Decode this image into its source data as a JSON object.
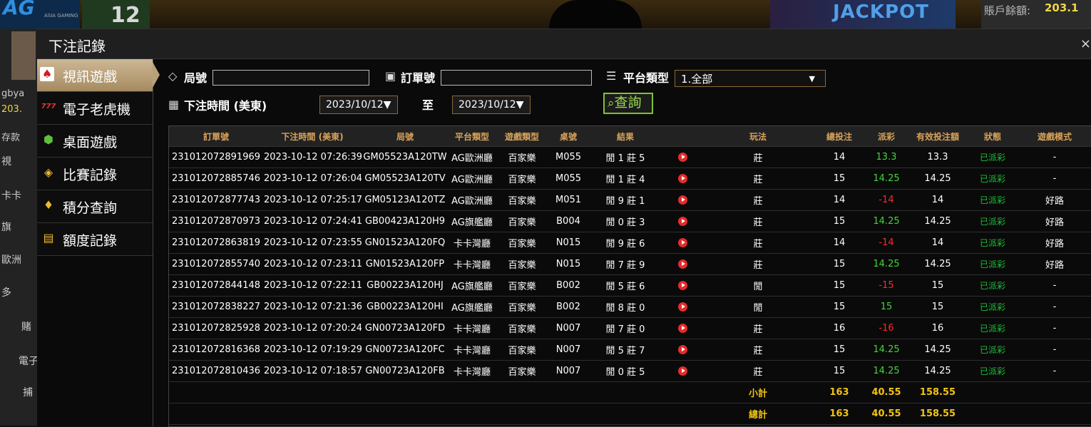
{
  "background": {
    "logo": "AG",
    "logo_sub": "ASIA GAMING",
    "round_count": "12",
    "jackpot": "JACKPOT",
    "balance_label": "賬戶餘額:",
    "balance_value": "203.1",
    "user_short": "gbya",
    "user_balance": "203.",
    "side_labels": [
      "存款",
      "視",
      "卡卡",
      "旗",
      "歐洲",
      "多",
      "賭",
      "電子",
      "捕"
    ]
  },
  "modal": {
    "title": "下注記錄",
    "close": "×"
  },
  "sidebar": {
    "items": [
      {
        "label": "視訊遊戲",
        "icon": "poker-cards-icon",
        "glyph": "🂡"
      },
      {
        "label": "電子老虎機",
        "icon": "slot-777-icon",
        "glyph": "777"
      },
      {
        "label": "桌面遊戲",
        "icon": "dice-icon",
        "glyph": "🎲"
      },
      {
        "label": "比賽記錄",
        "icon": "ticket-icon",
        "glyph": "◈"
      },
      {
        "label": "積分查詢",
        "icon": "diamond-icon",
        "glyph": "♦"
      },
      {
        "label": "額度記錄",
        "icon": "document-icon",
        "glyph": "▤"
      }
    ]
  },
  "filter": {
    "round_label": "局號",
    "round_value": "",
    "order_label": "訂單號",
    "order_value": "",
    "platform_label": "平台類型",
    "platform_value": "1.全部",
    "time_label": "下注時間 (美東)",
    "date_from": "2023/10/12▼",
    "date_to_label": "至",
    "date_to": "2023/10/12▼",
    "query_label": "查詢"
  },
  "table": {
    "headers": [
      "訂單號",
      "下注時間 (美東)",
      "局號",
      "平台類型",
      "遊戲類型",
      "桌號",
      "結果",
      "",
      "玩法",
      "總投注",
      "派彩",
      "有效投注額",
      "狀態",
      "遊戲模式"
    ],
    "rows": [
      [
        "231012072891969",
        "2023-10-12 07:26:39",
        "GM05523A120TW",
        "AG歐洲廳",
        "百家樂",
        "M055",
        "閒 1 莊 5",
        "莊",
        "14",
        "13.3",
        "13.3",
        "已派彩",
        "-",
        "green"
      ],
      [
        "231012072885746",
        "2023-10-12 07:26:04",
        "GM05523A120TV",
        "AG歐洲廳",
        "百家樂",
        "M055",
        "閒 1 莊 4",
        "莊",
        "15",
        "14.25",
        "14.25",
        "已派彩",
        "-",
        "green"
      ],
      [
        "231012072877743",
        "2023-10-12 07:25:17",
        "GM05123A120TZ",
        "AG歐洲廳",
        "百家樂",
        "M051",
        "閒 9 莊 1",
        "莊",
        "14",
        "-14",
        "14",
        "已派彩",
        "好路",
        "red"
      ],
      [
        "231012072870973",
        "2023-10-12 07:24:41",
        "GB00423A120H9",
        "AG旗艦廳",
        "百家樂",
        "B004",
        "閒 0 莊 3",
        "莊",
        "15",
        "14.25",
        "14.25",
        "已派彩",
        "好路",
        "green"
      ],
      [
        "231012072863819",
        "2023-10-12 07:23:55",
        "GN01523A120FQ",
        "卡卡灣廳",
        "百家樂",
        "N015",
        "閒 9 莊 6",
        "莊",
        "14",
        "-14",
        "14",
        "已派彩",
        "好路",
        "red"
      ],
      [
        "231012072855740",
        "2023-10-12 07:23:11",
        "GN01523A120FP",
        "卡卡灣廳",
        "百家樂",
        "N015",
        "閒 7 莊 9",
        "莊",
        "15",
        "14.25",
        "14.25",
        "已派彩",
        "好路",
        "green"
      ],
      [
        "231012072844148",
        "2023-10-12 07:22:11",
        "GB00223A120HJ",
        "AG旗艦廳",
        "百家樂",
        "B002",
        "閒 5 莊 6",
        "閒",
        "15",
        "-15",
        "15",
        "已派彩",
        "-",
        "red"
      ],
      [
        "231012072838227",
        "2023-10-12 07:21:36",
        "GB00223A120HI",
        "AG旗艦廳",
        "百家樂",
        "B002",
        "閒 8 莊 0",
        "閒",
        "15",
        "15",
        "15",
        "已派彩",
        "-",
        "green"
      ],
      [
        "231012072825928",
        "2023-10-12 07:20:24",
        "GN00723A120FD",
        "卡卡灣廳",
        "百家樂",
        "N007",
        "閒 7 莊 0",
        "莊",
        "16",
        "-16",
        "16",
        "已派彩",
        "-",
        "red"
      ],
      [
        "231012072816368",
        "2023-10-12 07:19:29",
        "GN00723A120FC",
        "卡卡灣廳",
        "百家樂",
        "N007",
        "閒 5 莊 7",
        "莊",
        "15",
        "14.25",
        "14.25",
        "已派彩",
        "-",
        "green"
      ],
      [
        "231012072810436",
        "2023-10-12 07:18:57",
        "GN00723A120FB",
        "卡卡灣廳",
        "百家樂",
        "N007",
        "閒 0 莊 5",
        "莊",
        "15",
        "14.25",
        "14.25",
        "已派彩",
        "-",
        "green"
      ]
    ],
    "subtotal": {
      "label": "小計",
      "bet": "163",
      "payout": "40.55",
      "valid": "158.55"
    },
    "total": {
      "label": "總計",
      "bet": "163",
      "payout": "40.55",
      "valid": "158.55"
    }
  }
}
